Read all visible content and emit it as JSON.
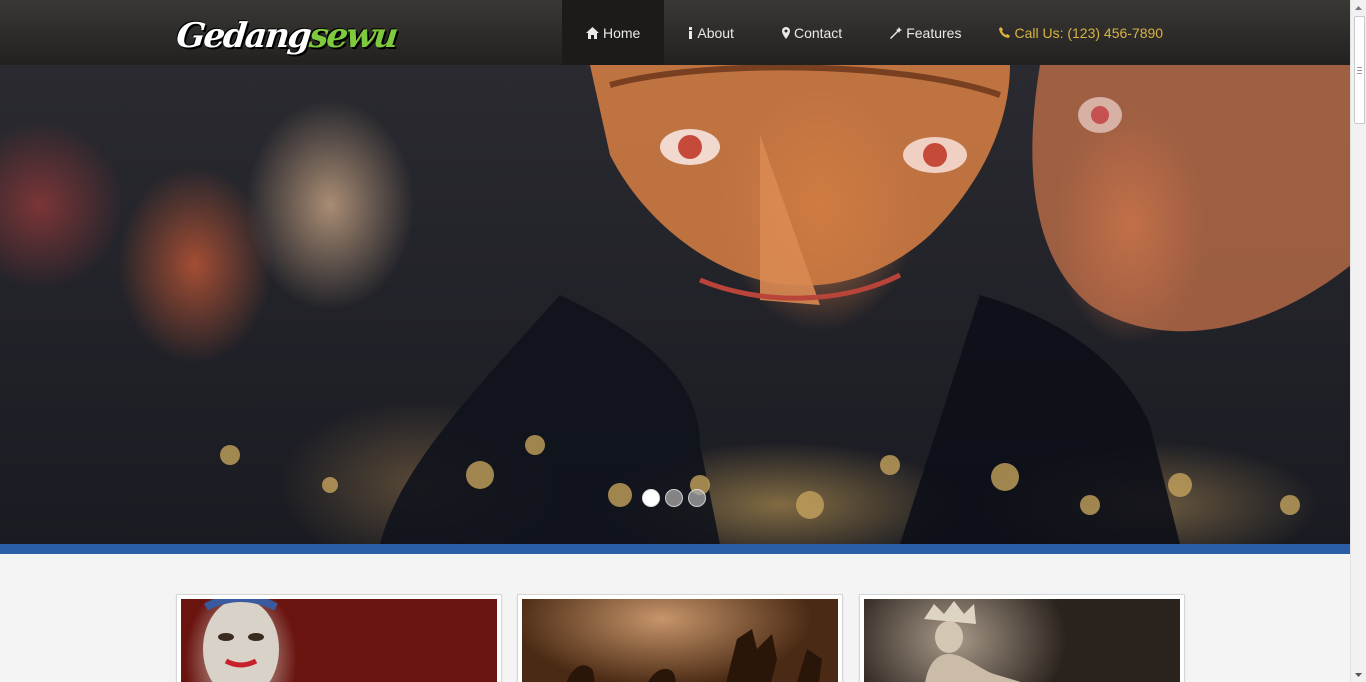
{
  "brand": {
    "part1": "Gedang",
    "part2": "sewu",
    "accent_color": "#7fc93e"
  },
  "nav": {
    "items": [
      {
        "label": "Home",
        "icon": "home-icon",
        "active": true
      },
      {
        "label": "About",
        "icon": "info-icon"
      },
      {
        "label": "Contact",
        "icon": "map-marker-icon"
      },
      {
        "label": "Features",
        "icon": "magic-wand-icon"
      }
    ],
    "phone": {
      "label": "Call Us: (123) 456-7890",
      "icon": "phone-icon",
      "color": "#d9b243"
    }
  },
  "slider": {
    "slide_count": 3,
    "active_index": 0
  },
  "colors": {
    "header": "#2b2926",
    "band": "#2c5da7",
    "page_bg": "#f4f4f4"
  },
  "cards": [
    {
      "image": "wayang mask photo"
    },
    {
      "image": "shadow puppet photo"
    },
    {
      "image": "dancer photo"
    }
  ]
}
